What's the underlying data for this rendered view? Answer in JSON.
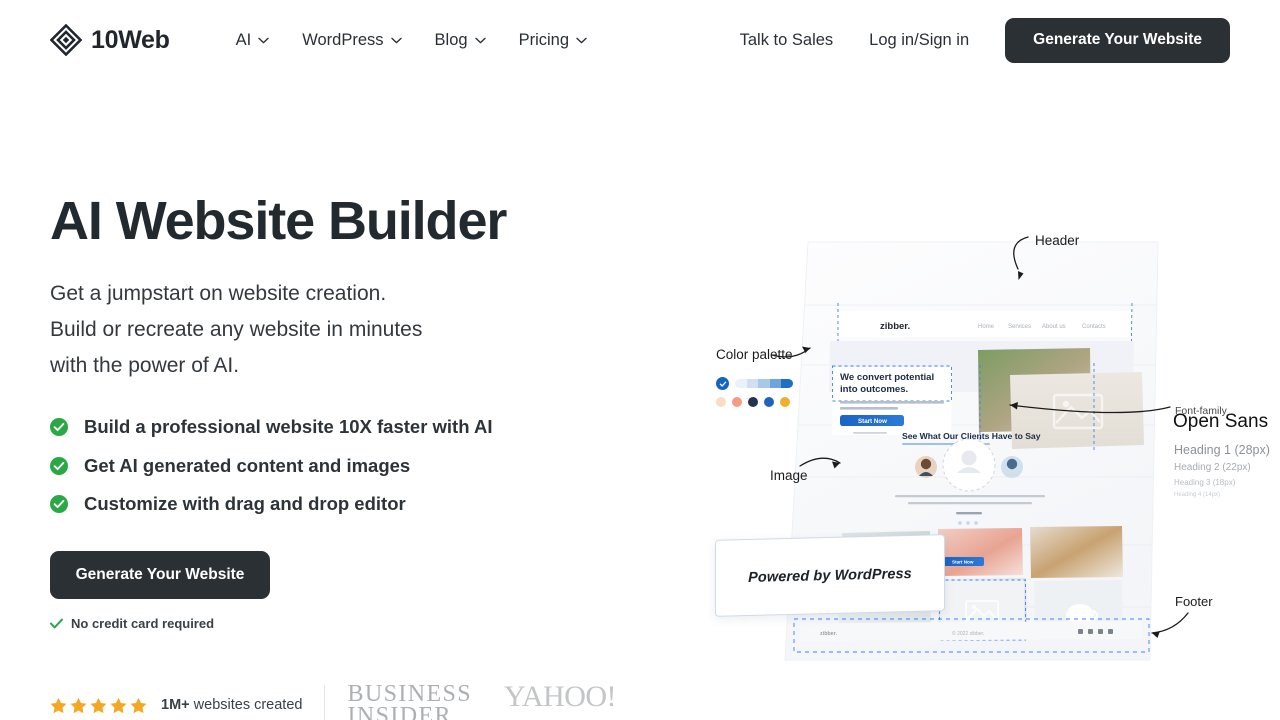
{
  "header": {
    "brand": "10Web",
    "brand_icon": "diamond-logo-icon",
    "nav": [
      {
        "label": "AI",
        "icon": "chevron-down-icon"
      },
      {
        "label": "WordPress",
        "icon": "chevron-down-icon"
      },
      {
        "label": "Blog",
        "icon": "chevron-down-icon"
      },
      {
        "label": "Pricing",
        "icon": "chevron-down-icon"
      }
    ],
    "talk_to_sales": "Talk to Sales",
    "login": "Log in/Sign in",
    "cta": "Generate Your Website",
    "cta_color": "#2b3034"
  },
  "hero": {
    "title": "AI Website Builder",
    "subtitle_lines": [
      "Get a jumpstart on website creation.",
      "Build or recreate any website in minutes",
      "with the power of AI."
    ],
    "bullets": [
      {
        "icon": "check-circle-icon",
        "text": "Build a professional website 10X faster with AI"
      },
      {
        "icon": "check-circle-icon",
        "text": "Get AI generated content and images"
      },
      {
        "icon": "check-circle-icon",
        "text": "Customize with drag and drop editor"
      }
    ],
    "cta": "Generate Your Website",
    "no_credit_card": "No credit card required",
    "no_credit_card_icon": "check-icon",
    "check_color": "#2aa845"
  },
  "social_proof": {
    "star_count": 5,
    "star_icon": "star-icon",
    "star_color": "#f5a623",
    "count": "1M+",
    "count_suffix": "websites created",
    "logos": [
      {
        "name": "business-insider-logo",
        "line1": "BUSINESS",
        "line2": "INSIDER"
      },
      {
        "name": "yahoo-logo",
        "text": "YAHOO!"
      }
    ]
  },
  "illustration": {
    "name": "ai-website-builder-mockup",
    "annotations": {
      "header": "Header",
      "color_palette": "Color palette",
      "image": "Image",
      "footer": "Footer",
      "font_family_label": "Font-family",
      "font_family_value": "Open Sans"
    },
    "type_scale": [
      "Heading 1 (28px)",
      "Heading 2 (22px)",
      "Heading 3 (18px)",
      "Heading 4 (14px)"
    ],
    "palette": {
      "gradient": [
        "#eaf1f9",
        "#cfe0f2",
        "#a8c8e8",
        "#6fa5db",
        "#1f6fc4"
      ],
      "dots": [
        "#fbdcc5",
        "#f59a84",
        "#23344f",
        "#1f63bf",
        "#f0ae2e"
      ]
    },
    "wordpress_badge": "Powered by WordPress",
    "mockup_site": {
      "brand": "zibber.",
      "nav": [
        "Home",
        "Services",
        "About us",
        "Contacts"
      ],
      "hero_heading_line1": "We convert potential",
      "hero_heading_line2": "into outcomes.",
      "hero_button": "Start Now",
      "testimonial_heading": "See What Our Clients Have to Say",
      "footer_brand": "zibber.",
      "footer_copyright": "© 2022 zibber.",
      "cta_button": "Start Now"
    }
  }
}
